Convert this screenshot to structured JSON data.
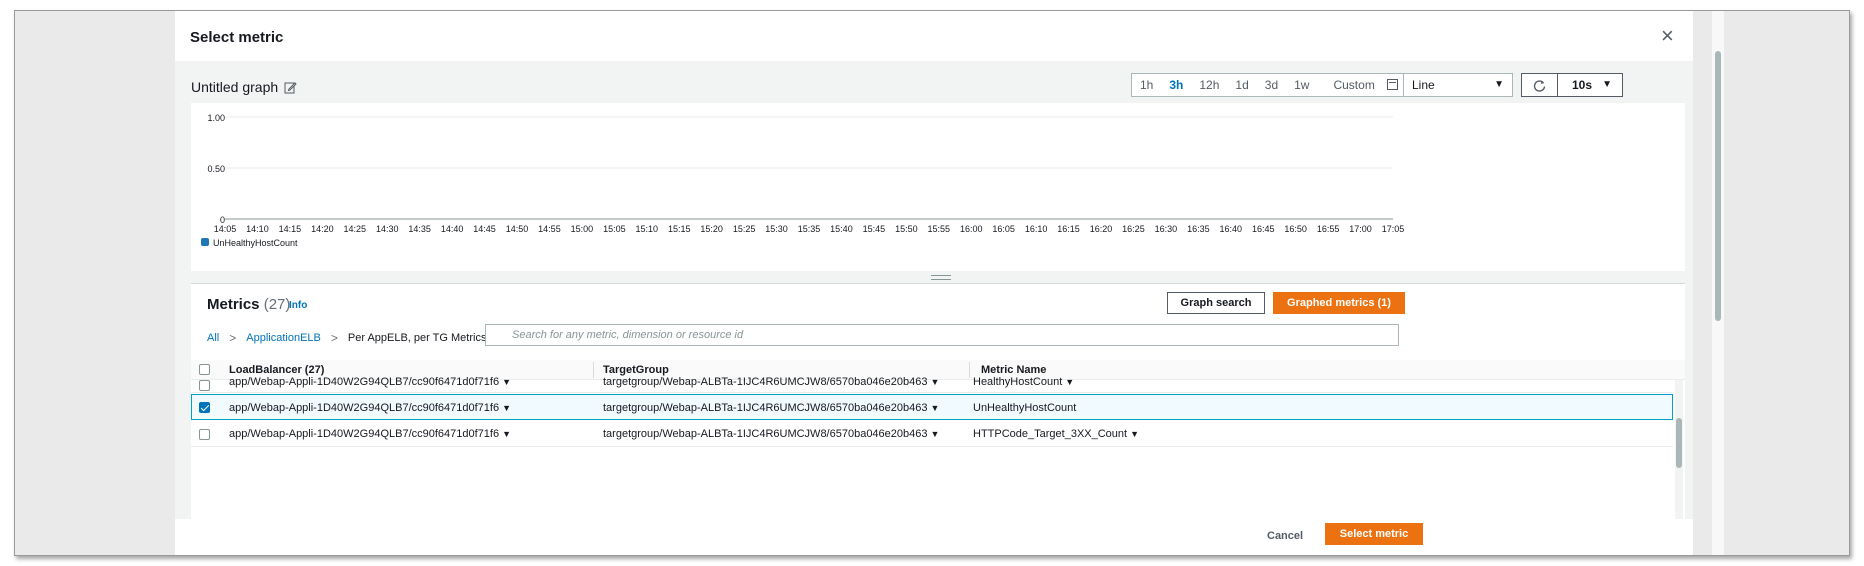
{
  "dialog": {
    "title": "Select metric",
    "close_symbol": "×"
  },
  "graph": {
    "title": "Untitled graph",
    "time_ranges": [
      "1h",
      "3h",
      "12h",
      "1d",
      "3d",
      "1w"
    ],
    "active_range": "3h",
    "custom_label": "Custom",
    "chart_type": "Line",
    "refresh_interval": "10s"
  },
  "chart_data": {
    "type": "line",
    "x": [
      "14:05",
      "14:10",
      "14:15",
      "14:20",
      "14:25",
      "14:30",
      "14:35",
      "14:40",
      "14:45",
      "14:50",
      "14:55",
      "15:00",
      "15:05",
      "15:10",
      "15:15",
      "15:20",
      "15:25",
      "15:30",
      "15:35",
      "15:40",
      "15:45",
      "15:50",
      "15:55",
      "16:00",
      "16:05",
      "16:10",
      "16:15",
      "16:20",
      "16:25",
      "16:30",
      "16:35",
      "16:40",
      "16:45",
      "16:50",
      "16:55",
      "17:00",
      "17:05"
    ],
    "y_ticks": [
      "1.00",
      "0.50",
      "0"
    ],
    "ylim": [
      0,
      1
    ],
    "series": [
      {
        "name": "UnHealthyHostCount",
        "values": [],
        "color": "#1f77b4"
      }
    ],
    "grid": true,
    "legend": "bottom-left"
  },
  "metrics": {
    "title": "Metrics",
    "count": "(27)",
    "info_label": "Info",
    "graph_search_label": "Graph search",
    "graphed_metrics_label": "Graphed metrics (1)",
    "breadcrumb": [
      "All",
      "ApplicationELB",
      "Per AppELB, per TG Metrics"
    ],
    "search_placeholder": "Search for any metric, dimension or resource id",
    "columns": [
      "LoadBalancer (27)",
      "TargetGroup",
      "Metric Name"
    ],
    "rows": [
      {
        "lb": "app/Webap-Appli-1D40W2G94QLB7/cc90f6471d0f71f6",
        "tg": "targetgroup/Webap-ALBTa-1IJC4R6UMCJW8/6570ba046e20b463",
        "metric": "HealthyHostCount",
        "checked": false
      },
      {
        "lb": "app/Webap-Appli-1D40W2G94QLB7/cc90f6471d0f71f6",
        "tg": "targetgroup/Webap-ALBTa-1IJC4R6UMCJW8/6570ba046e20b463",
        "metric": "UnHealthyHostCount",
        "checked": true
      },
      {
        "lb": "app/Webap-Appli-1D40W2G94QLB7/cc90f6471d0f71f6",
        "tg": "targetgroup/Webap-ALBTa-1IJC4R6UMCJW8/6570ba046e20b463",
        "metric": "HTTPCode_Target_3XX_Count",
        "checked": false
      }
    ]
  },
  "footer": {
    "cancel_label": "Cancel",
    "select_label": "Select metric"
  },
  "icons": {
    "edit": "edit-icon",
    "calendar": "calendar-icon",
    "refresh": "refresh-icon",
    "search": "search-icon",
    "dropdown": "▼",
    "chevron": ">"
  },
  "colors": {
    "accent": "#ec7211",
    "link": "#0073bb",
    "series": "#1f77b4"
  }
}
